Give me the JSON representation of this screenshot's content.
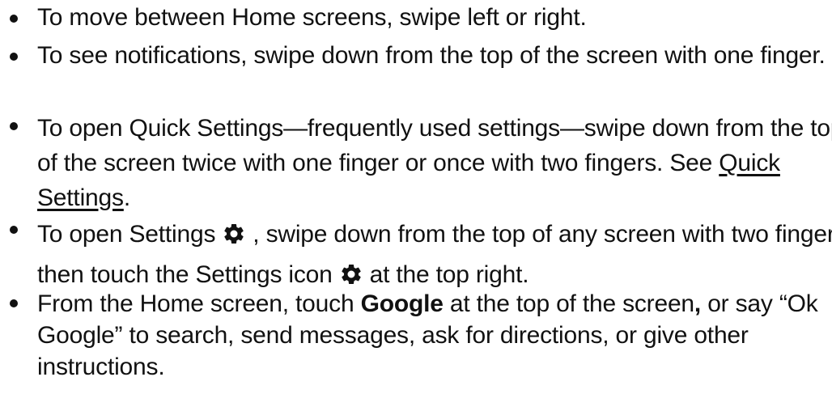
{
  "icons": {
    "settings": "gear-icon"
  },
  "items": [
    {
      "text": "To move between Home screens, swipe left or right."
    },
    {
      "text": "To see notifications, swipe down from the top of the screen with one finger."
    },
    {
      "text_before_link": "To open Quick Settings—frequently used settings—swipe down from the top of the screen twice with one finger or once with two fingers. See ",
      "link": "Quick Settings",
      "text_after_link": "."
    },
    {
      "text_a": "To open Settings",
      "text_b": ", swipe down from the top of any screen with two fingers, then touch the Settings icon",
      "text_c": "at the top right."
    },
    {
      "text_a": "From the Home screen, touch ",
      "bold": "Google",
      "text_b": " at the top of the screen",
      "bold_comma": ",",
      "text_c": " or say “Ok Google” to search, send messages, ask for directions, or give other instructions."
    }
  ]
}
